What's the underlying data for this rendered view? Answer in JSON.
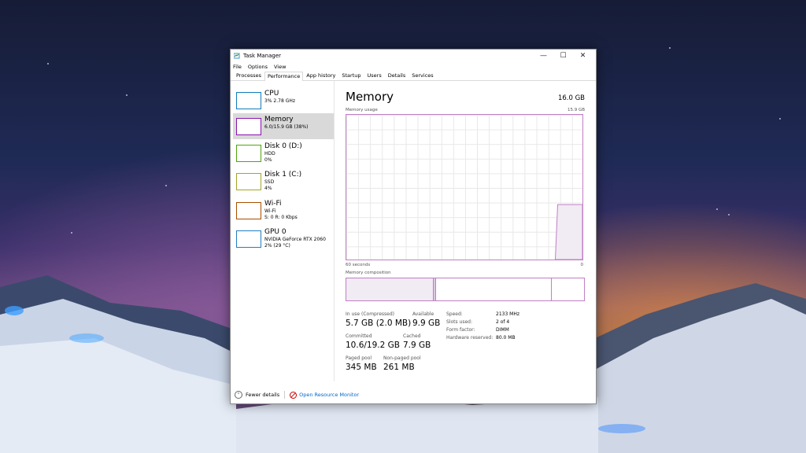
{
  "window": {
    "title": "Task Manager",
    "controls": {
      "minimize": "—",
      "maximize": "☐",
      "close": "✕"
    }
  },
  "menu": [
    "File",
    "Options",
    "View"
  ],
  "tabs": [
    "Processes",
    "Performance",
    "App history",
    "Startup",
    "Users",
    "Details",
    "Services"
  ],
  "sidebar": [
    {
      "name": "CPU",
      "lines": [
        "3% 2.78 GHz"
      ],
      "color": "#117dbb"
    },
    {
      "name": "Memory",
      "lines": [
        "6.0/15.9 GB (38%)"
      ],
      "color": "#8b12ae"
    },
    {
      "name": "Disk 0 (D:)",
      "lines": [
        "HDD",
        "0%"
      ],
      "color": "#4da60c"
    },
    {
      "name": "Disk 1 (C:)",
      "lines": [
        "SSD",
        "4%"
      ],
      "color": "#a3a72a"
    },
    {
      "name": "Wi-Fi",
      "lines": [
        "Wi-Fi",
        "S: 0 R: 0 Kbps"
      ],
      "color": "#a74f01"
    },
    {
      "name": "GPU 0",
      "lines": [
        "NVIDIA GeForce RTX 2060",
        "2% (29 °C)"
      ],
      "color": "#1f7fc1"
    }
  ],
  "main": {
    "title": "Memory",
    "total": "16.0 GB",
    "usage_label": "Memory usage",
    "usage_max": "15.9 GB",
    "time_label": "60 seconds",
    "time_zero": "0",
    "composition_label": "Memory composition",
    "usage_fraction": 0.38
  },
  "stats": {
    "in_use_label": "In use (Compressed)",
    "in_use": "5.7 GB (2.0 MB)",
    "available_label": "Available",
    "available": "9.9 GB",
    "committed_label": "Committed",
    "committed": "10.6/19.2 GB",
    "cached_label": "Cached",
    "cached": "7.9 GB",
    "paged_label": "Paged pool",
    "paged": "345 MB",
    "nonpaged_label": "Non-paged pool",
    "nonpaged": "261 MB"
  },
  "details": [
    {
      "k": "Speed:",
      "v": "2133 MHz"
    },
    {
      "k": "Slots used:",
      "v": "2 of 4"
    },
    {
      "k": "Form factor:",
      "v": "DIMM"
    },
    {
      "k": "Hardware reserved:",
      "v": "80.0 MB"
    }
  ],
  "footer": {
    "fewer": "Fewer details",
    "resmon": "Open Resource Monitor"
  },
  "colors": {
    "memory_accent": "#c07fc6",
    "link": "#0066cc"
  }
}
